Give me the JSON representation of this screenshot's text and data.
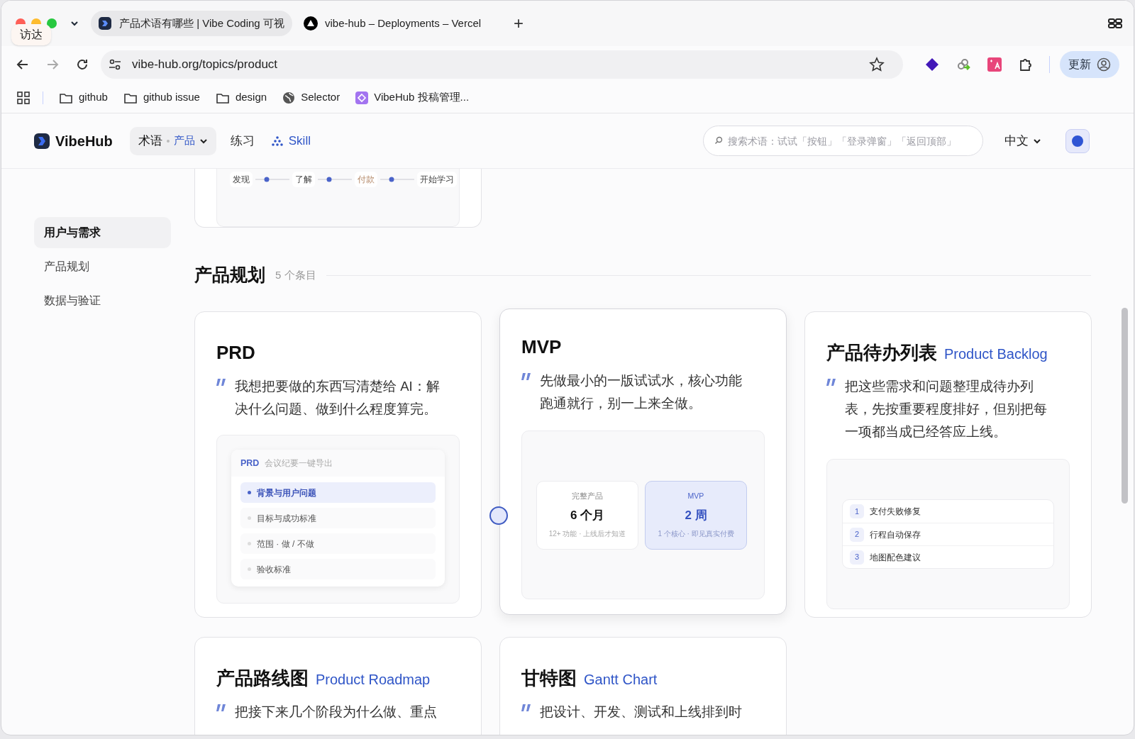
{
  "browser": {
    "tooltip": "访达",
    "tabs": [
      {
        "title": "产品术语有哪些 | Vibe Coding 可视",
        "kind": "site",
        "selected": true
      },
      {
        "title": "vibe-hub – Deployments – Vercel",
        "kind": "vercel",
        "selected": false
      }
    ],
    "new_tab": "+",
    "url": "vibe-hub.org/topics/product",
    "update_button": "更新",
    "bookmarks": [
      {
        "label": "github",
        "kind": "folder"
      },
      {
        "label": "github issue",
        "kind": "folder"
      },
      {
        "label": "design",
        "kind": "folder"
      },
      {
        "label": "Selector",
        "kind": "globe"
      },
      {
        "label": "VibeHub 投稿管理...",
        "kind": "app"
      }
    ]
  },
  "header": {
    "logo": "VibeHub",
    "nav": [
      {
        "label": "术语",
        "sub": "产品",
        "kind": "dropdown",
        "selected": true
      },
      {
        "label": "练习",
        "kind": "link",
        "selected": false
      },
      {
        "label": "Skill",
        "kind": "skill",
        "selected": false
      }
    ],
    "search": {
      "placeholder": "搜索术语：试试「按钮」「登录弹窗」「返回顶部」"
    },
    "language": "中文"
  },
  "sidebar": {
    "items": [
      {
        "label": "用户与需求",
        "selected": true
      },
      {
        "label": "产品规划",
        "selected": false
      },
      {
        "label": "数据与验证",
        "selected": false
      }
    ]
  },
  "flow": {
    "steps": [
      {
        "label": "发现",
        "highlight": false
      },
      {
        "label": "了解",
        "highlight": false
      },
      {
        "label": "付款",
        "highlight": true
      },
      {
        "label": "开始学习",
        "highlight": false
      }
    ]
  },
  "section": {
    "title": "产品规划",
    "count": "5 个条目"
  },
  "cards": [
    {
      "title": "PRD",
      "quote": "我想把要做的东西写清楚给 AI：解决什么问题、做到什么程度算完。",
      "raised": false,
      "kind": "doc",
      "doc": {
        "tag": "PRD",
        "subtitle": "会议纪要一键导出",
        "items": [
          {
            "label": "背景与用户问题",
            "selected": true
          },
          {
            "label": "目标与成功标准",
            "selected": false
          },
          {
            "label": "范围 · 做 / 不做",
            "selected": false
          },
          {
            "label": "验收标准",
            "selected": false
          }
        ]
      }
    },
    {
      "title": "MVP",
      "quote": "先做最小的一版试试水，核心功能跑通就行，别一上来全做。",
      "raised": true,
      "kind": "compare",
      "compare": [
        {
          "label": "完整产品",
          "value": "6 个月",
          "note": "12+ 功能 · 上线后才知道",
          "selected": false
        },
        {
          "label": "MVP",
          "value": "2 周",
          "note": "1 个核心 · 即见真实付费",
          "selected": true
        }
      ]
    },
    {
      "title": "产品待办列表",
      "english": "Product Backlog",
      "quote": "把这些需求和问题整理成待办列表，先按重要程度排好，但别把每一项都当成已经答应上线。",
      "raised": false,
      "kind": "list",
      "list": [
        {
          "number": "1",
          "label": "支付失败修复"
        },
        {
          "number": "2",
          "label": "行程自动保存"
        },
        {
          "number": "3",
          "label": "地图配色建议"
        }
      ]
    },
    {
      "title": "产品路线图",
      "english": "Product Roadmap",
      "quote": "把接下来几个阶段为什么做、重点",
      "raised": false,
      "kind": "none"
    },
    {
      "title": "甘特图",
      "english": "Gantt Chart",
      "quote": "把设计、开发、测试和上线排到时",
      "raised": false,
      "kind": "none"
    }
  ]
}
